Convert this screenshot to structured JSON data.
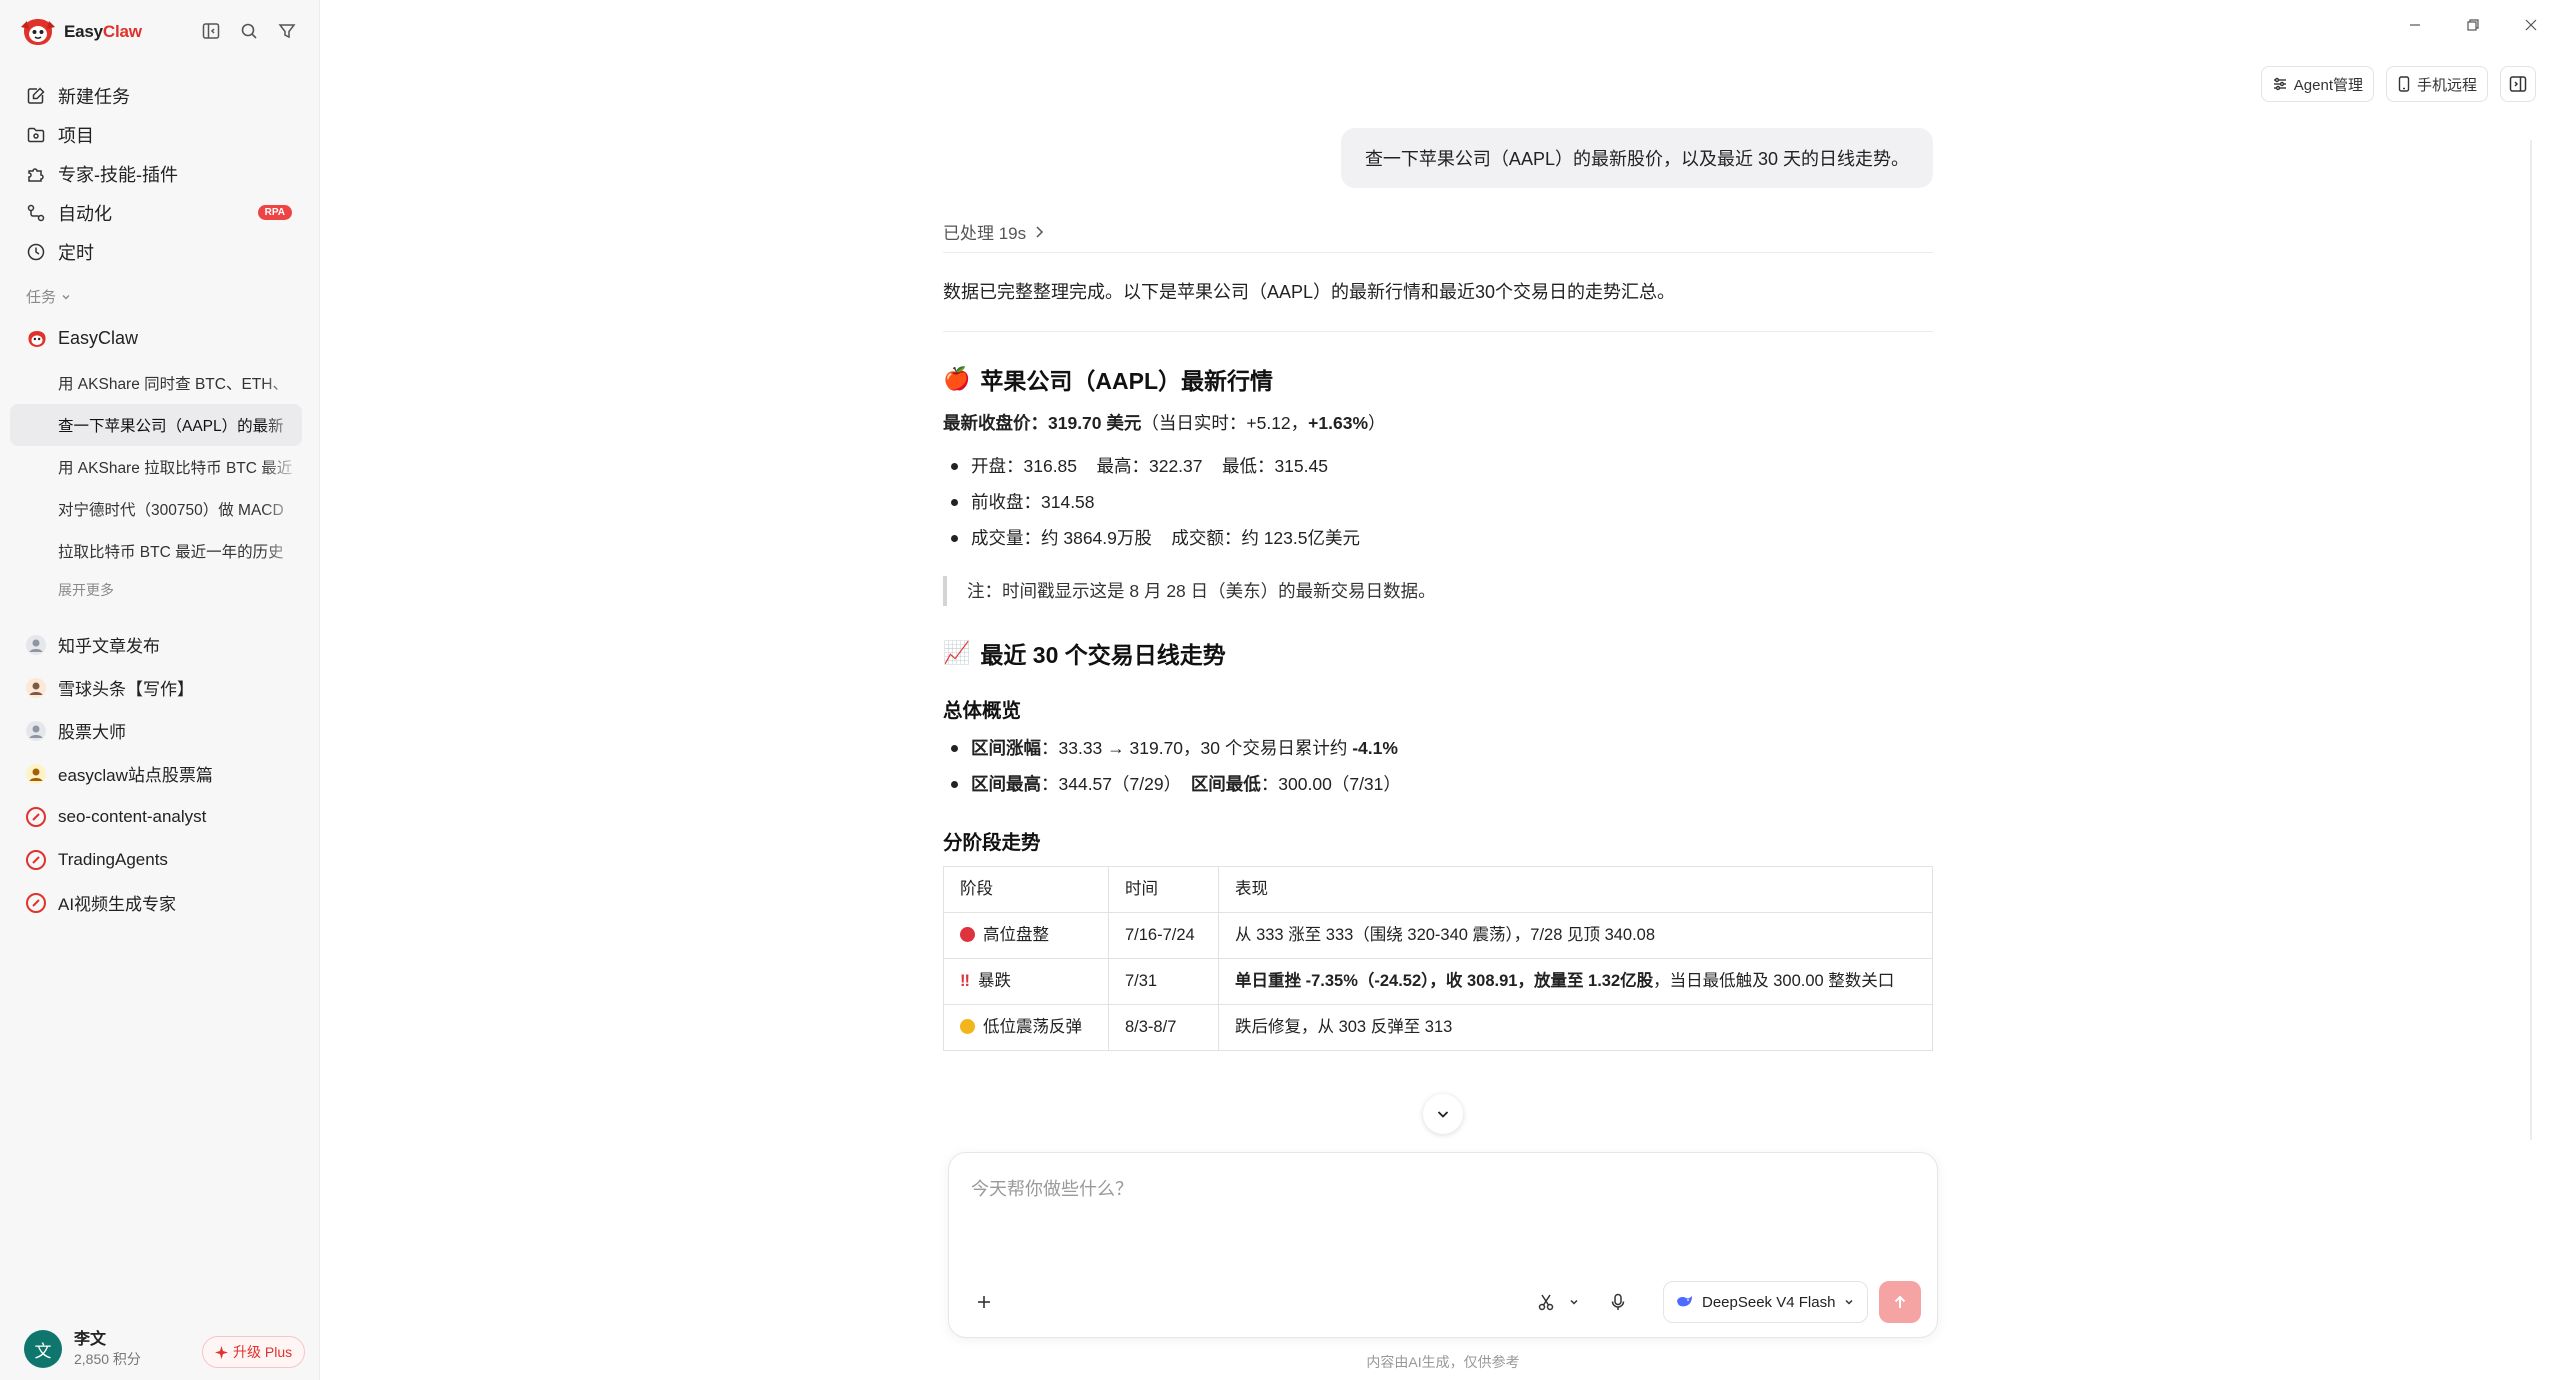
{
  "brand": {
    "name_part1": "Easy",
    "name_part2": "Claw"
  },
  "nav": [
    {
      "label": "新建任务",
      "icon": "new-task-icon"
    },
    {
      "label": "项目",
      "icon": "folder-icon"
    },
    {
      "label": "专家-技能-插件",
      "icon": "puzzle-icon"
    },
    {
      "label": "自动化",
      "icon": "automation-icon",
      "badge": "RPA"
    },
    {
      "label": "定时",
      "icon": "clock-icon"
    }
  ],
  "tasks_section": {
    "label": "任务"
  },
  "group": {
    "name": "EasyClaw"
  },
  "tasks": [
    "用 AKShare 同时查 BTC、ETH、",
    "查一下苹果公司（AAPL）的最新",
    "用 AKShare 拉取比特币 BTC 最近",
    "对宁德时代（300750）做 MACD",
    "拉取比特币 BTC 最近一年的历史"
  ],
  "expand_more": "展开更多",
  "agents": [
    {
      "name": "知乎文章发布"
    },
    {
      "name": "雪球头条【写作】"
    },
    {
      "name": "股票大师"
    },
    {
      "name": "easyclaw站点股票篇"
    },
    {
      "name": "seo-content-analyst"
    },
    {
      "name": "TradingAgents"
    },
    {
      "name": "AI视频生成专家"
    }
  ],
  "user": {
    "avatar_char": "文",
    "name": "李文",
    "points": "2,850 积分",
    "upgrade": "升级 Plus"
  },
  "top_buttons": {
    "agent": "Agent管理",
    "phone": "手机远程"
  },
  "chat": {
    "user_message": "查一下苹果公司（AAPL）的最新股价，以及最近 30 天的日线走势。",
    "processed": "已处理 19s",
    "intro": "数据已完整整理完成。以下是苹果公司（AAPL）的最新行情和最近30个交易日的走势汇总。",
    "section1": {
      "emoji": "🍎",
      "title": "苹果公司（AAPL）最新行情"
    },
    "close_label": "最新收盘价：",
    "close_value": "319.70 美元",
    "close_paren_a": "（当日实时：+5.12，",
    "close_pct": "+1.63%",
    "close_paren_b": "）",
    "bullets1": [
      "开盘：316.85    最高：322.37    最低：315.45",
      "前收盘：314.58",
      "成交量：约 3864.9万股    成交额：约 123.5亿美元"
    ],
    "note": "注：时间戳显示这是 8 月 28 日（美东）的最新交易日数据。",
    "section2": {
      "emoji": "📈",
      "title": "最近 30 个交易日线走势"
    },
    "overview_title": "总体概览",
    "range_change_label": "区间涨幅",
    "range_change_text": "：33.33 → 319.70，30 个交易日累计约 ",
    "range_change_pct": "-4.1%",
    "range_high_label": "区间最高",
    "range_high_text": "：344.57（7/29）  ",
    "range_low_label": "区间最低",
    "range_low_text": "：300.00（7/31）",
    "stage_title": "分阶段走势",
    "table": {
      "headers": [
        "阶段",
        "时间",
        "表现"
      ],
      "rows": [
        {
          "stage": "高位盘整",
          "marker_color": "#e0323c",
          "time": "7/16-7/24",
          "desc_bold": "",
          "desc": "从 333 涨至 333（围绕 320-340 震荡），7/28 见顶 340.08"
        },
        {
          "stage": "暴跌",
          "marker_color": "#e0323c",
          "time": "7/31",
          "desc_bold": "单日重挫 -7.35%（-24.52），收 308.91，放量至 1.32亿股",
          "desc": "，当日最低触及 300.00 整数关口"
        },
        {
          "stage": "低位震荡反弹",
          "marker_color": "#f3b51c",
          "time": "8/3-8/7",
          "desc_bold": "",
          "desc": "跌后修复，从 303 反弹至 313"
        }
      ]
    }
  },
  "composer": {
    "placeholder": "今天帮你做些什么？",
    "model": "DeepSeek V4 Flash"
  },
  "disclaimer": "内容由AI生成，仅供参考"
}
